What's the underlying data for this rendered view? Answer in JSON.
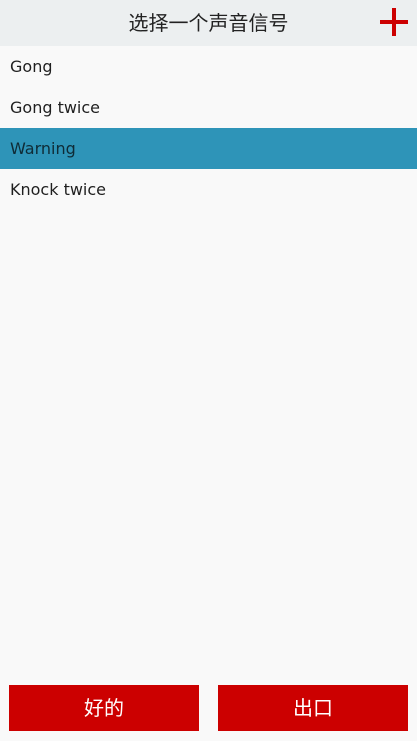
{
  "header": {
    "title": "选择一个声音信号",
    "add_icon": "plus-icon",
    "accent_color": "#cc0000"
  },
  "sounds": [
    {
      "label": "Gong",
      "selected": false
    },
    {
      "label": "Gong twice",
      "selected": false
    },
    {
      "label": "Warning",
      "selected": true
    },
    {
      "label": "Knock twice",
      "selected": false
    }
  ],
  "selection_color": "#2e94b8",
  "footer": {
    "ok_label": "好的",
    "exit_label": "出口",
    "button_color": "#cc0000"
  }
}
